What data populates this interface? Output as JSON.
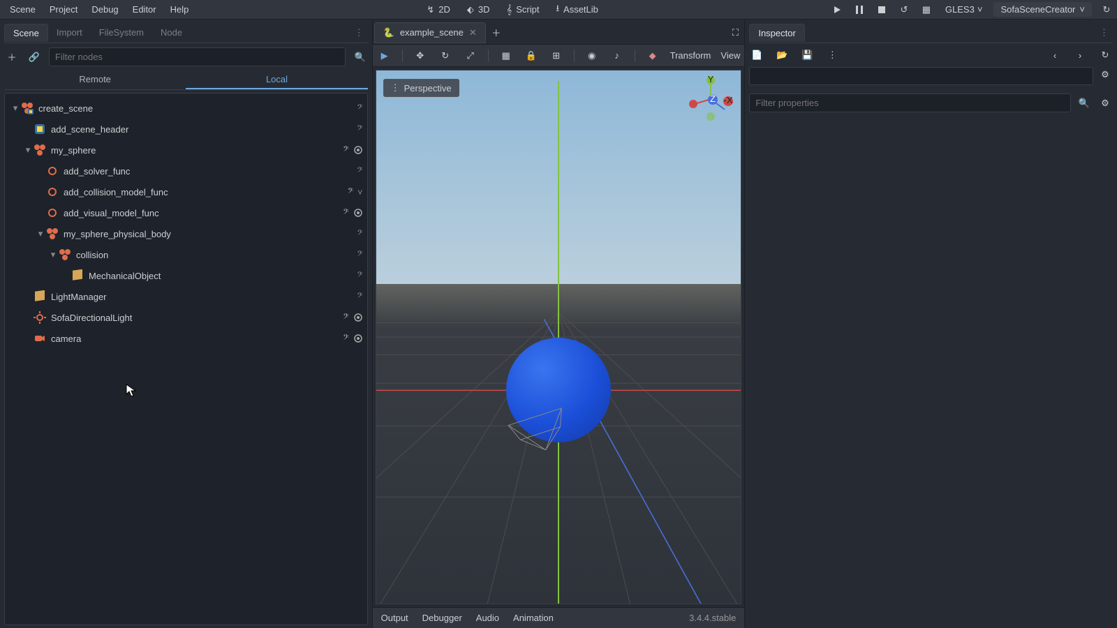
{
  "topmenu": {
    "items": [
      "Scene",
      "Project",
      "Debug",
      "Editor",
      "Help"
    ]
  },
  "modebar": {
    "d2": "2D",
    "d3": "3D",
    "script": "Script",
    "assetlib": "AssetLib"
  },
  "rightbar": {
    "renderer": "GLES3",
    "project": "SofaSceneCreator"
  },
  "dock": {
    "tabs": [
      "Scene",
      "Import",
      "FileSystem",
      "Node"
    ],
    "active": 0,
    "filter_ph": "Filter nodes",
    "remote": "Remote",
    "local": "Local"
  },
  "tree": [
    {
      "indent": 0,
      "arrow": "▾",
      "icon": "py-node",
      "name": "create_scene",
      "right": [
        "script"
      ]
    },
    {
      "indent": 1,
      "arrow": "",
      "icon": "py",
      "name": "add_scene_header",
      "right": [
        "script"
      ]
    },
    {
      "indent": 1,
      "arrow": "▾",
      "icon": "node",
      "name": "my_sphere",
      "right": [
        "script-o",
        "vis"
      ]
    },
    {
      "indent": 2,
      "arrow": "",
      "icon": "func",
      "name": "add_solver_func",
      "right": [
        "script"
      ]
    },
    {
      "indent": 2,
      "arrow": "",
      "icon": "func",
      "name": "add_collision_model_func",
      "right": [
        "script-o",
        "warn"
      ]
    },
    {
      "indent": 2,
      "arrow": "",
      "icon": "func",
      "name": "add_visual_model_func",
      "right": [
        "script-o",
        "vis"
      ]
    },
    {
      "indent": 2,
      "arrow": "▾",
      "icon": "node",
      "name": "my_sphere_physical_body",
      "right": [
        "script"
      ]
    },
    {
      "indent": 3,
      "arrow": "▾",
      "icon": "node",
      "name": "collision",
      "right": [
        "script"
      ]
    },
    {
      "indent": 4,
      "arrow": "",
      "icon": "mesh",
      "name": "MechanicalObject",
      "right": [
        "script"
      ]
    },
    {
      "indent": 1,
      "arrow": "",
      "icon": "mesh",
      "name": "LightManager",
      "right": [
        "script"
      ]
    },
    {
      "indent": 1,
      "arrow": "",
      "icon": "light",
      "name": "SofaDirectionalLight",
      "right": [
        "script-o",
        "vis"
      ]
    },
    {
      "indent": 1,
      "arrow": "",
      "icon": "cam",
      "name": "camera",
      "right": [
        "script-o",
        "vis"
      ]
    }
  ],
  "scenetab": {
    "name": "example_scene"
  },
  "vtoolbar": {
    "transform": "Transform",
    "view": "View"
  },
  "viewport": {
    "persp": "Perspective",
    "gizmo": {
      "y": "Y",
      "z": "Z",
      "x": "-X"
    }
  },
  "bottom": {
    "items": [
      "Output",
      "Debugger",
      "Audio",
      "Animation"
    ],
    "version": "3.4.4.stable"
  },
  "inspector": {
    "title": "Inspector",
    "filter_ph": "Filter properties"
  }
}
